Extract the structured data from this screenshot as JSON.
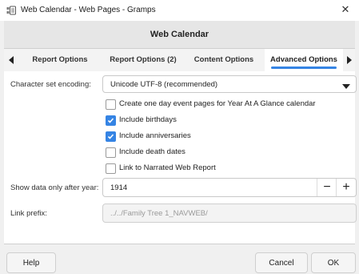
{
  "window": {
    "title": "Web Calendar - Web Pages - Gramps",
    "close_glyph": "✕"
  },
  "dialog": {
    "title": "Web Calendar"
  },
  "tabs": [
    {
      "label": "Report Options",
      "active": false
    },
    {
      "label": "Report Options (2)",
      "active": false
    },
    {
      "label": "Content Options",
      "active": false
    },
    {
      "label": "Advanced Options",
      "active": true
    }
  ],
  "form": {
    "encoding": {
      "label": "Character set encoding:",
      "value": "Unicode UTF-8 (recommended)"
    },
    "checkboxes": [
      {
        "label": "Create one day event pages for Year At A Glance calendar",
        "checked": false
      },
      {
        "label": "Include birthdays",
        "checked": true
      },
      {
        "label": "Include anniversaries",
        "checked": true
      },
      {
        "label": "Include death dates",
        "checked": false
      },
      {
        "label": "Link to Narrated Web Report",
        "checked": false
      }
    ],
    "after_year": {
      "label": "Show data only after year:",
      "value": "1914",
      "minus": "−",
      "plus": "+"
    },
    "link_prefix": {
      "label": "Link prefix:",
      "value": "../../Family Tree 1_NAVWEB/"
    }
  },
  "buttons": {
    "help": "Help",
    "cancel": "Cancel",
    "ok": "OK"
  },
  "colors": {
    "accent": "#3584e4",
    "background": "#f0f0f0",
    "panel": "#ffffff"
  },
  "icons": {
    "app": "gramps-app-icon",
    "close": "close-icon",
    "tab_left": "chevron-left-icon",
    "tab_right": "chevron-right-icon",
    "combo": "chevron-down-icon",
    "check": "checkmark-icon"
  }
}
